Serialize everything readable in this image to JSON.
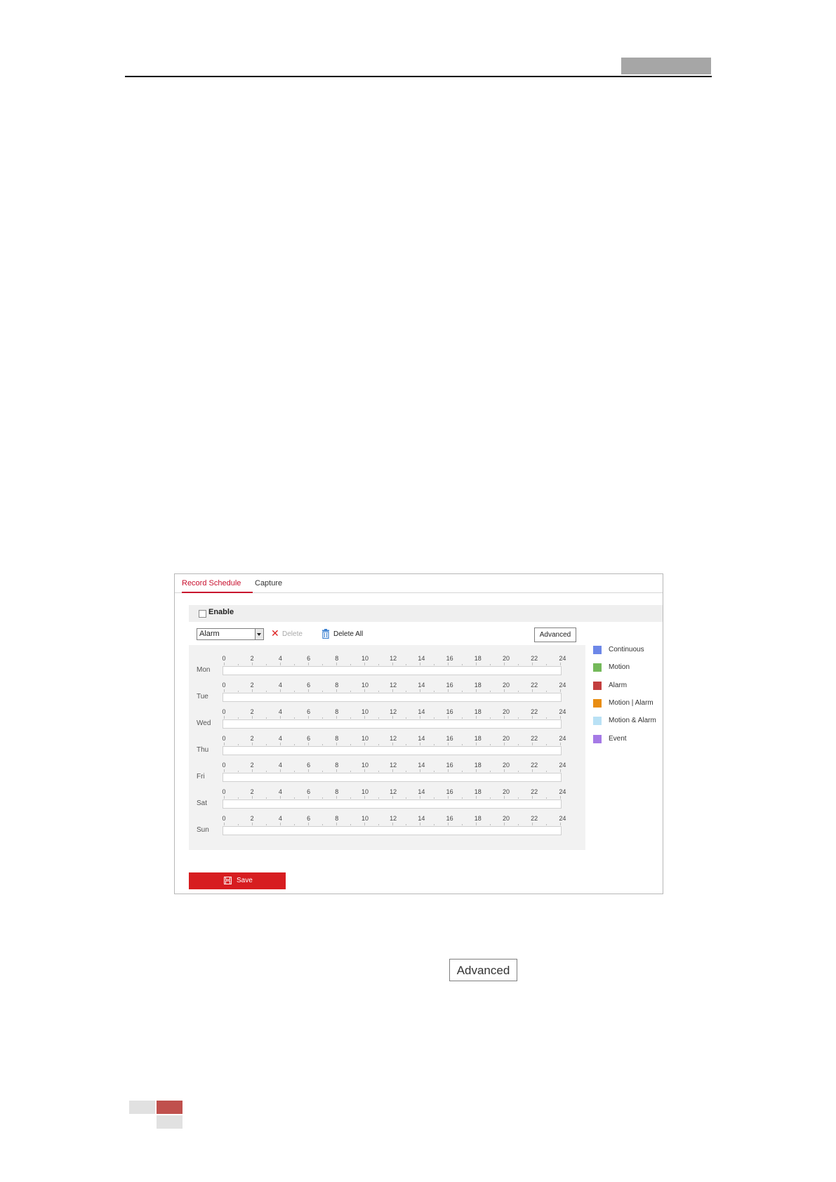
{
  "tabs": [
    {
      "label": "Record Schedule",
      "active": true
    },
    {
      "label": "Capture",
      "active": false
    }
  ],
  "enable": {
    "label": "Enable",
    "checked": false
  },
  "toolbar": {
    "record_type": "Alarm",
    "delete_label": "Delete",
    "delete_all_label": "Delete All",
    "advanced_label": "Advanced"
  },
  "schedule": {
    "days": [
      "Mon",
      "Tue",
      "Wed",
      "Thu",
      "Fri",
      "Sat",
      "Sun"
    ],
    "hour_ticks": [
      "0",
      "2",
      "4",
      "6",
      "8",
      "10",
      "12",
      "14",
      "16",
      "18",
      "20",
      "22",
      "24"
    ]
  },
  "legend": [
    {
      "label": "Continuous",
      "color": "#6d87e8"
    },
    {
      "label": "Motion",
      "color": "#74b95a"
    },
    {
      "label": "Alarm",
      "color": "#c33e3e"
    },
    {
      "label": "Motion | Alarm",
      "color": "#e98d12"
    },
    {
      "label": "Motion & Alarm",
      "color": "#b9e1f5"
    },
    {
      "label": "Event",
      "color": "#a57ae6"
    }
  ],
  "save_label": "Save",
  "advanced_button_large": "Advanced"
}
